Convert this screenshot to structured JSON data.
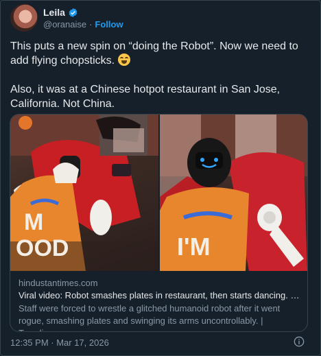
{
  "author": {
    "name": "Leila",
    "handle": "@oranaise",
    "follow_label": "Follow",
    "separator": "·"
  },
  "tweet": {
    "line1": "This puts a new spin on “doing the Robot”. Now we need to add flying chopsticks.",
    "line2": "Also, it was at a Chinese hotpot restaurant in San Jose, California. Not China."
  },
  "card": {
    "domain": "hindustantimes.com",
    "title": "Viral video: Robot smashes plates in restaurant, then starts dancing. Staff...",
    "description": "Staff were forced to wrestle a glitched humanoid robot after it went rogue, smashing plates and swinging its arms uncontrollably. | Trending",
    "apron_left": "M\nOOD",
    "apron_right": "I'M"
  },
  "timestamp": "12:35 PM · Mar 17, 2026",
  "colors": {
    "accent": "#1d9bf0",
    "background": "#15202b",
    "secondary_text": "#8b98a5"
  }
}
